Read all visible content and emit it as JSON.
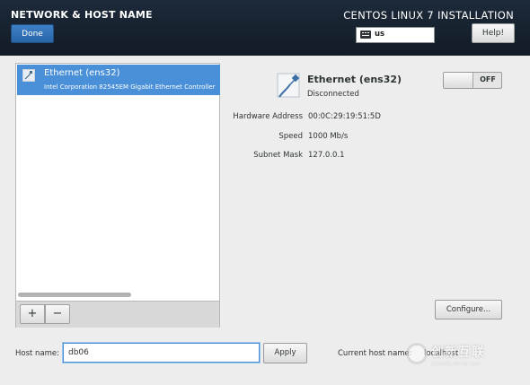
{
  "header": {
    "spoke_title": "NETWORK & HOST NAME",
    "done_label": "Done",
    "product_title": "CENTOS LINUX 7 INSTALLATION",
    "keyboard_layout": "us",
    "help_label": "Help!"
  },
  "device_list": {
    "items": [
      {
        "name": "Ethernet (ens32)",
        "description": "Intel Corporation 82545EM Gigabit Ethernet Controller",
        "selected": true,
        "icon": "ethernet-cable-icon"
      }
    ],
    "add_label": "+",
    "remove_label": "−"
  },
  "details": {
    "device_name": "Ethernet (ens32)",
    "status": "Disconnected",
    "toggle_label": "OFF",
    "properties": [
      {
        "label": "Hardware Address",
        "value": "00:0C:29:19:51:5D"
      },
      {
        "label": "Speed",
        "value": "1000 Mb/s"
      },
      {
        "label": "Subnet Mask",
        "value": "127.0.0.1"
      }
    ],
    "configure_label": "Configure..."
  },
  "hostname": {
    "label": "Host name:",
    "value": "db06",
    "apply_label": "Apply",
    "current_label": "Current host name:",
    "current_value": "localhost"
  },
  "watermark": {
    "text": "创新互联",
    "subtext": "CHUANG XIN HU LIAN"
  },
  "colors": {
    "header_bg": "#17212e",
    "selection": "#4a90d9",
    "done_button": "#3273b8"
  }
}
